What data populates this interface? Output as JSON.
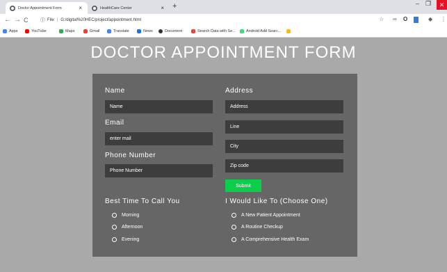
{
  "browser": {
    "tabs": [
      {
        "title": "Doctor Appointment Form",
        "close": "×",
        "active": true
      },
      {
        "title": "HealthCare Center",
        "close": "×",
        "active": false
      }
    ],
    "new_tab": "+",
    "window_controls": {
      "minimize": "–",
      "maximize": "❐",
      "close": "✕"
    },
    "nav": {
      "back": "←",
      "forward": "→",
      "reload": "C"
    },
    "address": {
      "scheme": "File",
      "url": "G:/digital%20HEC/project/appointment.html"
    },
    "bookmarks": [
      {
        "label": "Apps",
        "color": "#4285f4"
      },
      {
        "label": "YouTube",
        "color": "#ff0000"
      },
      {
        "label": "Maps",
        "color": "#34a853"
      },
      {
        "label": "Gmail",
        "color": "#ea4335"
      },
      {
        "label": "Translate",
        "color": "#4285f4"
      },
      {
        "label": "News",
        "color": "#1a73e8"
      },
      {
        "label": "Document",
        "color": "#333333"
      },
      {
        "label": "Search Data with Se...",
        "color": "#e8453c"
      },
      {
        "label": "Android Add Searc...",
        "color": "#3ddc84"
      }
    ]
  },
  "page": {
    "title": "DOCTOR APPOINTMENT FORM",
    "left": {
      "name_label": "Name",
      "name_placeholder": "Name",
      "email_label": "Email",
      "email_placeholder": "enter mail",
      "phone_label": "Phone Number",
      "phone_placeholder": "Phone Number"
    },
    "right": {
      "address_label": "Address",
      "address_placeholder": "Address",
      "line_placeholder": "Line",
      "city_placeholder": "City",
      "zip_placeholder": "Zip code",
      "submit_label": "Submit"
    },
    "call_time": {
      "heading": "Best Time To Call You",
      "options": [
        "Morning",
        "Afternoon",
        "Evening"
      ]
    },
    "choice": {
      "heading": "I Would Like To (Choose One)",
      "options": [
        "A New Patient Appointment",
        "A Routine Checkup",
        "A Comprehensive Health Exam"
      ]
    }
  },
  "colors": {
    "page_bg": "#a9a9a9",
    "panel_bg": "#666666",
    "field_bg": "#3d3d3d",
    "submit_bg": "#0bce4a"
  }
}
